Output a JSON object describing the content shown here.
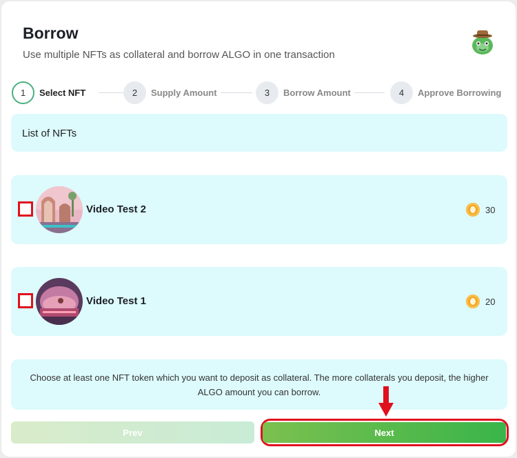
{
  "header": {
    "title": "Borrow",
    "subtitle": "Use multiple NFTs as collateral and borrow ALGO in one transaction",
    "mascot_icon": "mascot-avatar-icon"
  },
  "steps": [
    {
      "number": "1",
      "label": "Select NFT",
      "active": true
    },
    {
      "number": "2",
      "label": "Supply Amount",
      "active": false
    },
    {
      "number": "3",
      "label": "Borrow Amount",
      "active": false
    },
    {
      "number": "4",
      "label": "Approve Borrowing",
      "active": false
    }
  ],
  "list": {
    "heading": "List of NFTs",
    "items": [
      {
        "name": "Video Test 2",
        "price": "30",
        "checked": false,
        "price_icon": "algo-coin-icon"
      },
      {
        "name": "Video Test 1",
        "price": "20",
        "checked": false,
        "price_icon": "algo-coin-icon"
      }
    ]
  },
  "info": {
    "text": "Choose at least one NFT token which you want to deposit as collateral. The more collaterals you deposit, the higher ALGO amount you can borrow."
  },
  "buttons": {
    "prev_label": "Prev",
    "next_label": "Next"
  },
  "colors": {
    "panel_bg": "#ddfafc",
    "accent_green": "#39b54a",
    "highlight_red": "#e0101d",
    "coin": "#f5a623"
  }
}
